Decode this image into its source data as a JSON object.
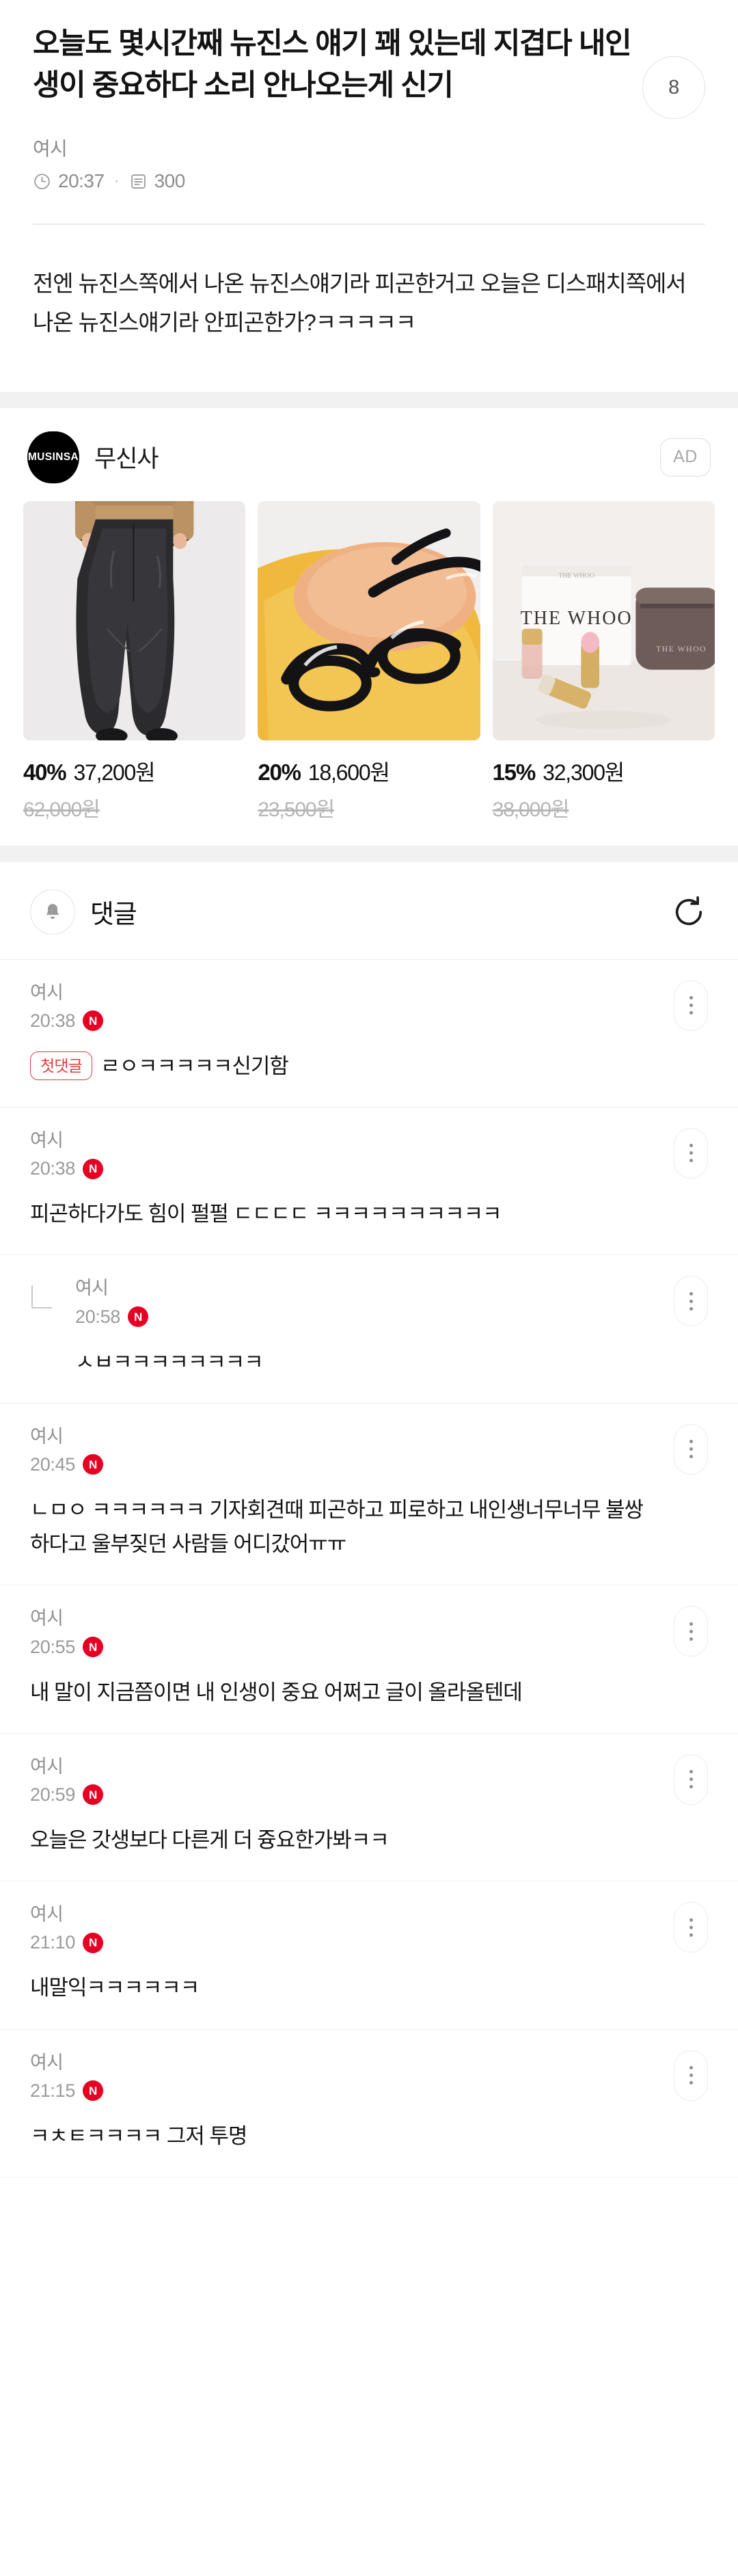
{
  "post": {
    "title": "오늘도 몇시간째 뉴진스 얘기 꽤 있는데 지겹다 내인생이 중요하다 소리 안나오는게 신기",
    "author": "여시",
    "time": "20:37",
    "views": "300",
    "dot": "·",
    "like_count": "8",
    "body": "전엔 뉴진스쪽에서 나온 뉴진스얘기라 피곤한거고 오늘은 디스패치쪽에서 나온 뉴진스얘기라 안피곤한가?ㅋㅋㅋㅋㅋ",
    "clock_icon": "clock-icon",
    "views_icon": "document-icon"
  },
  "ad": {
    "logo_text": "MUSINSA",
    "brand": "무신사",
    "flag": "AD",
    "products": [
      {
        "name": "black-wide-pants",
        "discount": "40%",
        "price": "37,200원",
        "original": "62,000원"
      },
      {
        "name": "black-eyeglasses",
        "discount": "20%",
        "price": "18,600원",
        "original": "23,500원"
      },
      {
        "name": "the-whoo-lip-set",
        "discount": "15%",
        "price": "32,300원",
        "original": "38,000원",
        "box_label": "THE WHOO",
        "pouch_label": "THE WHOO"
      }
    ]
  },
  "comments_section": {
    "title": "댓글",
    "bell_icon": "bell-icon",
    "refresh_icon": "refresh-icon",
    "menu_icon": "kebab-menu-icon",
    "new_badge": "N",
    "first_tag": "첫댓글",
    "comments": [
      {
        "user": "여시",
        "time": "20:38",
        "is_new": true,
        "is_reply": false,
        "first": true,
        "text": "ㄹㅇㅋㅋㅋㅋㅋ신기함"
      },
      {
        "user": "여시",
        "time": "20:38",
        "is_new": true,
        "is_reply": false,
        "first": false,
        "text": "피곤하다가도 힘이 펄펄 ㄷㄷㄷㄷ ㅋㅋㅋㅋㅋㅋㅋㅋㅋㅋ"
      },
      {
        "user": "여시",
        "time": "20:58",
        "is_new": true,
        "is_reply": true,
        "first": false,
        "text": "ㅅㅂㅋㅋㅋㅋㅋㅋㅋㅋ"
      },
      {
        "user": "여시",
        "time": "20:45",
        "is_new": true,
        "is_reply": false,
        "first": false,
        "text": "ㄴㅁㅇ ㅋㅋㅋㅋㅋㅋ 기자회견때 피곤하고 피로하고 내인생너무너무 불쌍하다고 울부짖던 사람들 어디갔어ㅠㅠ"
      },
      {
        "user": "여시",
        "time": "20:55",
        "is_new": true,
        "is_reply": false,
        "first": false,
        "text": "내 말이 지금쯤이면 내 인생이 중요 어쩌고 글이 올라올텐데"
      },
      {
        "user": "여시",
        "time": "20:59",
        "is_new": true,
        "is_reply": false,
        "first": false,
        "text": "오늘은 갓생보다 다른게 더 즁요한가봐ㅋㅋ"
      },
      {
        "user": "여시",
        "time": "21:10",
        "is_new": true,
        "is_reply": false,
        "first": false,
        "text": "내말익ㅋㅋㅋㅋㅋㅋ"
      },
      {
        "user": "여시",
        "time": "21:15",
        "is_new": true,
        "is_reply": false,
        "first": false,
        "text": "ㅋㅊㅌㅋㅋㅋㅋ 그저 투명"
      }
    ]
  },
  "colors": {
    "accent_red": "#e60023",
    "first_tag": "#e23b3b",
    "text": "#131313",
    "muted": "#8f8f8f"
  }
}
